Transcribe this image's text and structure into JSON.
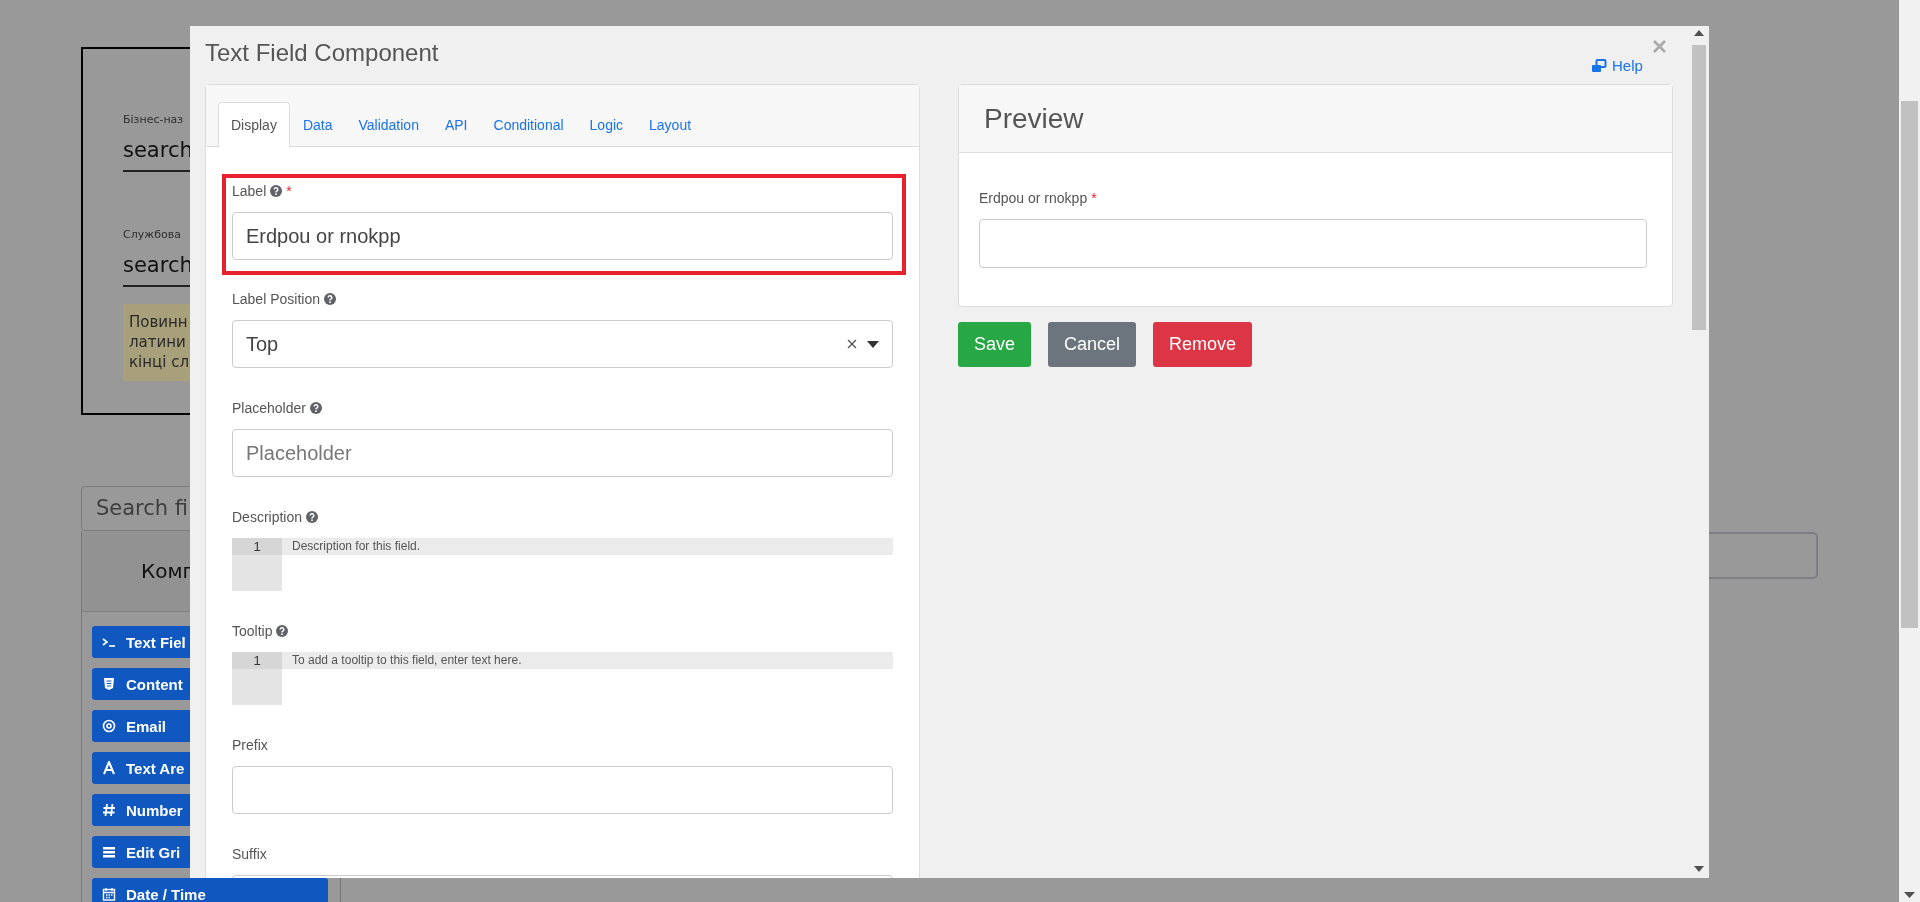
{
  "background_page": {
    "form_fields": [
      {
        "label": "Бізнес-наз",
        "value": "search"
      },
      {
        "label": "Службова",
        "value": "search"
      }
    ],
    "note_lines": [
      "Повинн",
      "латини",
      "кінці сл"
    ],
    "search": {
      "placeholder": "Search fi"
    },
    "components_panel": {
      "title": "Комп",
      "items": [
        {
          "label": "Text Fiel"
        },
        {
          "label": "Content"
        },
        {
          "label": "Email"
        },
        {
          "label": "Text Are"
        },
        {
          "label": "Number"
        },
        {
          "label": "Edit Gri"
        },
        {
          "label": "Date / Time"
        }
      ]
    }
  },
  "modal": {
    "title": "Text Field Component",
    "help": "Help",
    "tabs": [
      {
        "label": "Display",
        "selected": true
      },
      {
        "label": "Data",
        "selected": false
      },
      {
        "label": "Validation",
        "selected": false
      },
      {
        "label": "API",
        "selected": false
      },
      {
        "label": "Conditional",
        "selected": false
      },
      {
        "label": "Logic",
        "selected": false
      },
      {
        "label": "Layout",
        "selected": false
      }
    ],
    "fields": [
      {
        "kind": "input",
        "label": "Label",
        "help": true,
        "required_mark": "*",
        "value": "Erdpou or rnokpp",
        "highlighted": true
      },
      {
        "kind": "select",
        "label": "Label Position",
        "help": true,
        "value": "Top"
      },
      {
        "kind": "input",
        "label": "Placeholder",
        "help": true,
        "placeholder": "Placeholder"
      },
      {
        "kind": "code",
        "label": "Description",
        "help": true,
        "line_number": "1",
        "placeholder": "Description for this field."
      },
      {
        "kind": "code",
        "label": "Tooltip",
        "help": true,
        "line_number": "1",
        "placeholder": "To add a tooltip to this field, enter text here."
      },
      {
        "kind": "input",
        "label": "Prefix",
        "help": false
      },
      {
        "kind": "input",
        "label": "Suffix",
        "help": false
      }
    ],
    "preview": {
      "title": "Preview",
      "field_label": "Erdpou or rnokpp",
      "required_mark": "*"
    },
    "buttons": [
      {
        "label": "Save",
        "kind": "success"
      },
      {
        "label": "Cancel",
        "kind": "secondary"
      },
      {
        "label": "Remove",
        "kind": "danger"
      }
    ]
  }
}
